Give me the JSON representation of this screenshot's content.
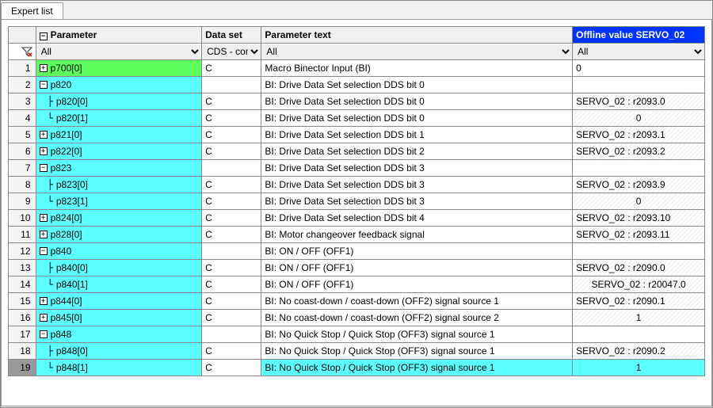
{
  "tab": {
    "label": "Expert list"
  },
  "header": {
    "rownum": "",
    "parameter": "Parameter",
    "dataset": "Data set",
    "ptext": "Parameter text",
    "offline": "Offline value SERVO_02"
  },
  "filter": {
    "param": "All",
    "dataset": "CDS - com",
    "ptext": "All",
    "offline": "All"
  },
  "rows": [
    {
      "n": 1,
      "toggle": "+",
      "indent": 0,
      "param": "p700[0]",
      "paramBg": "green",
      "dataset": "C",
      "ptext": "Macro Binector Input (BI)",
      "offline": "0",
      "offlineStyle": "plain"
    },
    {
      "n": 2,
      "toggle": "-",
      "indent": 0,
      "param": "p820",
      "paramBg": "cyan",
      "dataset": "",
      "ptext": "BI: Drive Data Set selection DDS bit 0",
      "offline": "",
      "offlineStyle": "plain"
    },
    {
      "n": 3,
      "toggle": "",
      "indent": 1,
      "line": "├",
      "param": "p820[0]",
      "paramBg": "cyan",
      "dataset": "C",
      "ptext": "BI: Drive Data Set selection DDS bit 0",
      "offline": "SERVO_02 : r2093.0",
      "offlineStyle": "hatch"
    },
    {
      "n": 4,
      "toggle": "",
      "indent": 1,
      "line": "└",
      "param": "p820[1]",
      "paramBg": "cyan",
      "dataset": "C",
      "ptext": "BI: Drive Data Set selection DDS bit 0",
      "offline": "0",
      "offlineStyle": "hatch-center"
    },
    {
      "n": 5,
      "toggle": "+",
      "indent": 0,
      "param": "p821[0]",
      "paramBg": "cyan",
      "dataset": "C",
      "ptext": "BI: Drive Data Set selection DDS bit 1",
      "offline": "SERVO_02 : r2093.1",
      "offlineStyle": "hatch"
    },
    {
      "n": 6,
      "toggle": "+",
      "indent": 0,
      "param": "p822[0]",
      "paramBg": "cyan",
      "dataset": "C",
      "ptext": "BI: Drive Data Set selection DDS bit 2",
      "offline": "SERVO_02 : r2093.2",
      "offlineStyle": "hatch"
    },
    {
      "n": 7,
      "toggle": "-",
      "indent": 0,
      "param": "p823",
      "paramBg": "cyan",
      "dataset": "",
      "ptext": "BI: Drive Data Set selection DDS bit 3",
      "offline": "",
      "offlineStyle": "plain"
    },
    {
      "n": 8,
      "toggle": "",
      "indent": 1,
      "line": "├",
      "param": "p823[0]",
      "paramBg": "cyan",
      "dataset": "C",
      "ptext": "BI: Drive Data Set selection DDS bit 3",
      "offline": "SERVO_02 : r2093.9",
      "offlineStyle": "hatch"
    },
    {
      "n": 9,
      "toggle": "",
      "indent": 1,
      "line": "└",
      "param": "p823[1]",
      "paramBg": "cyan",
      "dataset": "C",
      "ptext": "BI: Drive Data Set selection DDS bit 3",
      "offline": "0",
      "offlineStyle": "hatch-center"
    },
    {
      "n": 10,
      "toggle": "+",
      "indent": 0,
      "param": "p824[0]",
      "paramBg": "cyan",
      "dataset": "C",
      "ptext": "BI: Drive Data Set selection DDS bit 4",
      "offline": "SERVO_02 : r2093.10",
      "offlineStyle": "hatch"
    },
    {
      "n": 11,
      "toggle": "+",
      "indent": 0,
      "param": "p828[0]",
      "paramBg": "cyan",
      "dataset": "C",
      "ptext": "BI: Motor changeover feedback signal",
      "offline": "SERVO_02 : r2093.11",
      "offlineStyle": "hatch"
    },
    {
      "n": 12,
      "toggle": "-",
      "indent": 0,
      "param": "p840",
      "paramBg": "cyan",
      "dataset": "",
      "ptext": "BI: ON / OFF (OFF1)",
      "offline": "",
      "offlineStyle": "plain"
    },
    {
      "n": 13,
      "toggle": "",
      "indent": 1,
      "line": "├",
      "param": "p840[0]",
      "paramBg": "cyan",
      "dataset": "C",
      "ptext": "BI: ON / OFF (OFF1)",
      "offline": "SERVO_02 : r2090.0",
      "offlineStyle": "hatch"
    },
    {
      "n": 14,
      "toggle": "",
      "indent": 1,
      "line": "└",
      "param": "p840[1]",
      "paramBg": "cyan",
      "dataset": "C",
      "ptext": "BI: ON / OFF (OFF1)",
      "offline": "SERVO_02 : r20047.0",
      "offlineStyle": "hatch-center"
    },
    {
      "n": 15,
      "toggle": "+",
      "indent": 0,
      "param": "p844[0]",
      "paramBg": "cyan",
      "dataset": "C",
      "ptext": "BI: No coast-down / coast-down (OFF2) signal source 1",
      "offline": "SERVO_02 : r2090.1",
      "offlineStyle": "hatch"
    },
    {
      "n": 16,
      "toggle": "+",
      "indent": 0,
      "param": "p845[0]",
      "paramBg": "cyan",
      "dataset": "C",
      "ptext": "BI: No coast-down / coast-down (OFF2) signal source 2",
      "offline": "1",
      "offlineStyle": "hatch-center"
    },
    {
      "n": 17,
      "toggle": "-",
      "indent": 0,
      "param": "p848",
      "paramBg": "cyan",
      "dataset": "",
      "ptext": "BI: No Quick Stop / Quick Stop (OFF3) signal source 1",
      "offline": "",
      "offlineStyle": "plain"
    },
    {
      "n": 18,
      "toggle": "",
      "indent": 1,
      "line": "├",
      "param": "p848[0]",
      "paramBg": "cyan",
      "dataset": "C",
      "ptext": "BI: No Quick Stop / Quick Stop (OFF3) signal source 1",
      "offline": "SERVO_02 : r2090.2",
      "offlineStyle": "hatch"
    },
    {
      "n": 19,
      "toggle": "",
      "indent": 1,
      "line": "└",
      "param": "p848[1]",
      "paramBg": "cyan",
      "dataset": "C",
      "ptext": "BI: No Quick Stop / Quick Stop (OFF3) signal source 1",
      "offline": "1",
      "offlineStyle": "cyan-center",
      "selected": true
    }
  ]
}
